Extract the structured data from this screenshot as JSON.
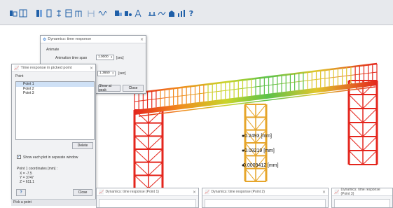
{
  "toolbar": {
    "icons": [
      "model-icon",
      "grid-icon",
      "bar-icon",
      "section-icon",
      "scale-icon",
      "table-icon",
      "frame-icon",
      "wave-icon",
      "magnet-icon",
      "diagram-icon",
      "load-icon",
      "support-icon",
      "curve-icon",
      "building-icon",
      "stats-icon"
    ],
    "help_label": "?"
  },
  "dynamic_panel": {
    "title": "Dynamics: time response",
    "animate_label": "Animate",
    "span_label": "Animation time span",
    "span_value": "1.0000",
    "span_unit": "[sec]",
    "time_value": "1.3650",
    "time_unit": "[sec]",
    "show_peak_label": "Show at peak",
    "close_label": "Close"
  },
  "point_panel": {
    "title": "Time response in picked point",
    "section_label": "Point",
    "points": [
      "Point 1",
      "Point 2",
      "Point 3"
    ],
    "delete_label": "Delete",
    "checkbox_label": "Show each plot in separate window",
    "coords_heading": "Point 1 coordinates [mm] :",
    "coord_x": "X = -7.5",
    "coord_y": "Y = 3747",
    "coord_z": "Z = 611.1",
    "help_label": "?",
    "close_label": "Close"
  },
  "status_bar": {
    "text": "Pick a point"
  },
  "annotations": {
    "a1": "0.2493 [mm]",
    "a2": "0.09219 [mm]",
    "a3": "0.0009412 [mm]"
  },
  "plot_windows": {
    "titles": [
      "Dynamics: time response (Point 1)",
      "Dynamics: time response (Point 2)",
      "Dynamics: time response (Point 3)"
    ]
  },
  "colors": {
    "accent": "#1f6fd1",
    "structure_red": "#e4261d",
    "panel_bg": "#f1f2f4"
  }
}
